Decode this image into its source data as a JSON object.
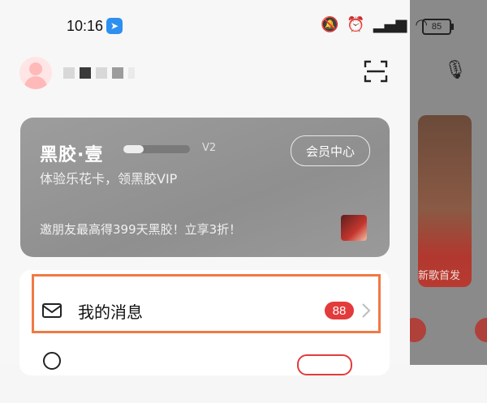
{
  "status_bar": {
    "time": "10:16",
    "battery": "85"
  },
  "vip_card": {
    "title": "黑胶·壹",
    "level": "V2",
    "level_progress": 0.3,
    "center_button": "会员中心",
    "subtitle": "体验乐花卡，领黑胶VIP",
    "promo": "邀朋友最高得399天黑胶！立享3折！"
  },
  "menu": {
    "messages": {
      "label": "我的消息",
      "badge": "88"
    }
  },
  "background_app": {
    "tag": "新歌首发"
  },
  "colors": {
    "badge": "#e33b3b",
    "highlight": "#f07a45",
    "vip_card": "#959595"
  }
}
